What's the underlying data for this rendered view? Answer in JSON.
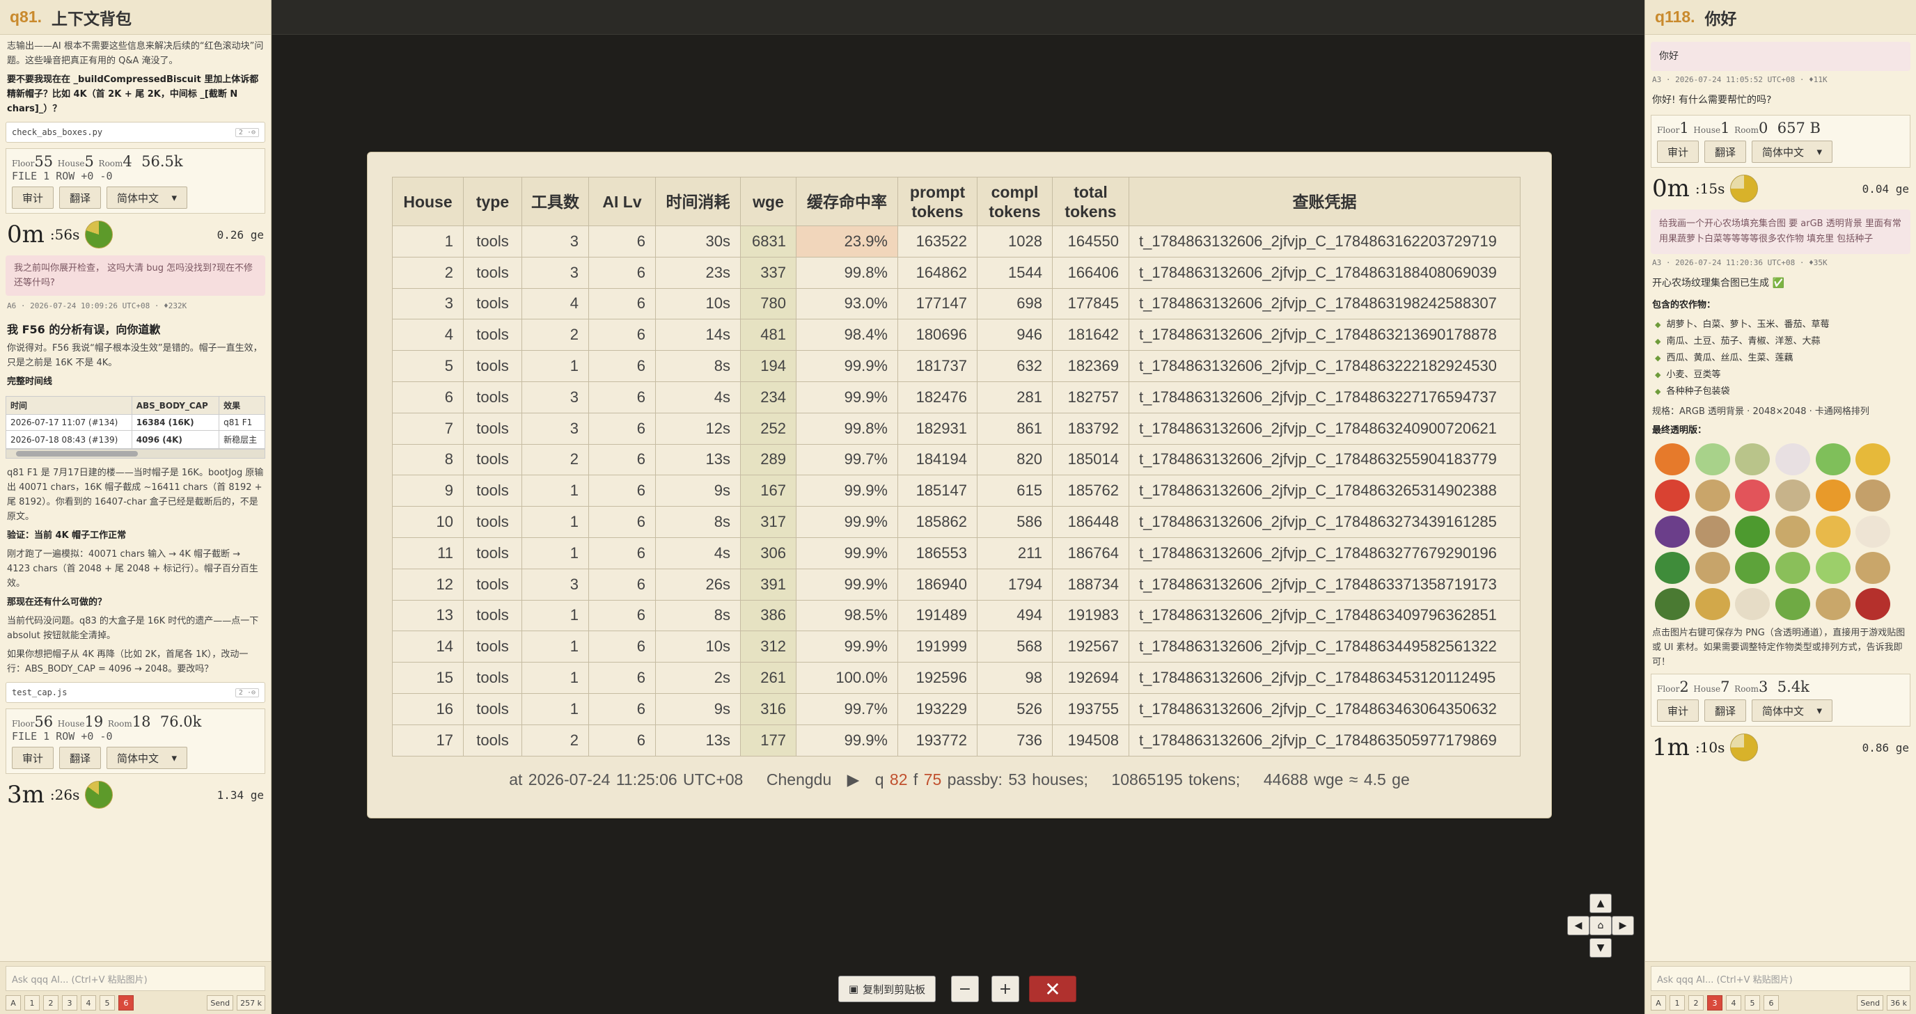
{
  "left_panel": {
    "q_number": "q81.",
    "title": "上下文背包",
    "intro": "志输出——AI 根本不需要这些信息来解决后续的“红色滚动块”问题。这些噪音把真正有用的 Q&A 淹没了。",
    "q1": "要不要我现在在 _buildCompressedBiscuit 里加上体诉都精新帽子？比如 4K（首 2K + 尾 2K，中间标 _[截断 N chars]_）？",
    "code1": "check_abs_boxes.py",
    "code1_badge": "2 ·⊖",
    "stats1": {
      "floor": "55",
      "house": "5",
      "room": "4",
      "size": "56.5k",
      "line2": "FILE 1  ROW +0 -0"
    },
    "btn_review": "审计",
    "btn_translate": "翻译",
    "lang": "简体中文",
    "timer1": {
      "min": "0m",
      "sec": ":56s",
      "ge": "0.26 ge"
    },
    "pink1": "我之前叫你展开检查，  这吗大清 bug 怎吗没找到?现在不修还等什吗?",
    "meta1": "A6 · 2026-07-24 10:09:26 UTC+08 · ♦232K",
    "h_f56": "我 F56 的分析有误，向你道歉",
    "p_f56": "你说得对。F56 我说“帽子根本没生效”是错的。帽子一直生效，只是之前是 16K 不是 4K。",
    "timeline_head": "完整时间线",
    "mini_table": {
      "headers": [
        "时间",
        "ABS_BODY_CAP",
        "效果"
      ],
      "rows": [
        [
          "2026-07-17 11:07 (#134)",
          "16384 (16K)",
          "q81 F1"
        ],
        [
          "2026-07-18 08:43 (#139)",
          "4096 (4K)",
          "新稳层主"
        ]
      ]
    },
    "p2": "q81 F1 是 7月17日建的楼——当时帽子是 16K。bootJog 原输出 40071 chars，16K 帽子截成 ~16411 chars（首 8192 + 尾 8192）。你看到的 16407-char 盒子已经是截断后的，不是原文。",
    "h_verify": "验证：当前 4K 帽子工作正常",
    "p3": "刚才跑了一遍模拟：40071 chars 输入 → 4K 帽子截断 → 4123 chars（首 2048 + 尾 2048 + 标记行）。帽子百分百生效。",
    "h_why": "那现在还有什么可做的？",
    "p4": "当前代码没问题。q83 的大盒子是 16K 时代的遗产——点一下 absolut 按钮就能全清掉。",
    "p5": "如果你想把帽子从 4K 再降（比如 2K，首尾各 1K），改动一行：ABS_BODY_CAP = 4096 → 2048。要改吗？",
    "code2": "test_cap.js",
    "code2_badge": "2 ·⊖",
    "stats2": {
      "floor": "56",
      "house": "19",
      "room": "18",
      "size": "76.0k",
      "line2": "FILE 1  ROW +0 -0"
    },
    "timer2": {
      "min": "3m",
      "sec": ":26s",
      "ge": "1.34 ge"
    },
    "ask_placeholder": "Ask qqq AI... (Ctrl+V 粘贴图片)",
    "pages": [
      "A",
      "1",
      "2",
      "3",
      "4",
      "5",
      "6"
    ],
    "active_page": "6",
    "send": "Send",
    "tokens": "257 k"
  },
  "right_panel": {
    "q_number": "q118.",
    "title": "你好",
    "bubble1": "你好",
    "meta1": "A3 · 2026-07-24 11:05:52 UTC+08 · ♦11K",
    "answer1": "你好! 有什么需要帮忙的吗?",
    "stats1": {
      "floor": "1",
      "house": "1",
      "room": "0",
      "size": "657 B"
    },
    "btn_review": "审计",
    "btn_translate": "翻译",
    "lang": "简体中文",
    "timer1": {
      "min": "0m",
      "sec": ":15s",
      "ge": "0.04 ge"
    },
    "bubble2": "给我画一个开心农场填充集合图 要 arGB 透明背景 里面有常用果蔬萝卜白菜等等等等很多农作物 填充里 包括种子",
    "meta2": "A3 · 2026-07-24 11:20:36 UTC+08 · ♦35K",
    "done": "开心农场纹理集合图已生成 ✅",
    "contains": "包含的农作物：",
    "crops": [
      "胡萝卜、白菜、萝卜、玉米、番茄、草莓",
      "南瓜、土豆、茄子、青椒、洋葱、大蒜",
      "西瓜、黄瓜、丝瓜、生菜、莲藕",
      "小麦、豆类等",
      "各种种子包装袋"
    ],
    "spec": "规格：ARGB 透明背景 · 2048×2048 · 卡通网格排列",
    "final": "最终透明版：",
    "save_note": "点击图片右键可保存为 PNG（含透明通道），直接用于游戏贴图或 UI 素材。如果需要调整特定作物类型或排列方式，告诉我即可！",
    "stats2": {
      "floor": "2",
      "house": "7",
      "room": "3",
      "size": "5.4k"
    },
    "timer2": {
      "min": "1m",
      "sec": ":10s",
      "ge": "0.86 ge"
    },
    "ask_placeholder": "Ask qqq AI... (Ctrl+V 粘贴图片)",
    "pages": [
      "A",
      "1",
      "2",
      "3",
      "4",
      "5",
      "6"
    ],
    "active_page": "3",
    "send": "Send",
    "tokens": "36 k"
  },
  "modal": {
    "headers": [
      "House",
      "type",
      "工具数",
      "AI Lv",
      "时间消耗",
      "wge",
      "缓存命中率",
      "prompt tokens",
      "compl tokens",
      "total tokens",
      "查账凭据"
    ],
    "rows": [
      [
        "1",
        "tools",
        "3",
        "6",
        "30s",
        "6831",
        "23.9%",
        "163522",
        "1028",
        "164550",
        "t_1784863132606_2jfvjp_C_1784863162203729719"
      ],
      [
        "2",
        "tools",
        "3",
        "6",
        "23s",
        "337",
        "99.8%",
        "164862",
        "1544",
        "166406",
        "t_1784863132606_2jfvjp_C_1784863188408069039"
      ],
      [
        "3",
        "tools",
        "4",
        "6",
        "10s",
        "780",
        "93.0%",
        "177147",
        "698",
        "177845",
        "t_1784863132606_2jfvjp_C_1784863198242588307"
      ],
      [
        "4",
        "tools",
        "2",
        "6",
        "14s",
        "481",
        "98.4%",
        "180696",
        "946",
        "181642",
        "t_1784863132606_2jfvjp_C_1784863213690178878"
      ],
      [
        "5",
        "tools",
        "1",
        "6",
        "8s",
        "194",
        "99.9%",
        "181737",
        "632",
        "182369",
        "t_1784863132606_2jfvjp_C_1784863222182924530"
      ],
      [
        "6",
        "tools",
        "3",
        "6",
        "4s",
        "234",
        "99.9%",
        "182476",
        "281",
        "182757",
        "t_1784863132606_2jfvjp_C_1784863227176594737"
      ],
      [
        "7",
        "tools",
        "3",
        "6",
        "12s",
        "252",
        "99.8%",
        "182931",
        "861",
        "183792",
        "t_1784863132606_2jfvjp_C_1784863240900720621"
      ],
      [
        "8",
        "tools",
        "2",
        "6",
        "13s",
        "289",
        "99.7%",
        "184194",
        "820",
        "185014",
        "t_1784863132606_2jfvjp_C_1784863255904183779"
      ],
      [
        "9",
        "tools",
        "1",
        "6",
        "9s",
        "167",
        "99.9%",
        "185147",
        "615",
        "185762",
        "t_1784863132606_2jfvjp_C_1784863265314902388"
      ],
      [
        "10",
        "tools",
        "1",
        "6",
        "8s",
        "317",
        "99.9%",
        "185862",
        "586",
        "186448",
        "t_1784863132606_2jfvjp_C_1784863273439161285"
      ],
      [
        "11",
        "tools",
        "1",
        "6",
        "4s",
        "306",
        "99.9%",
        "186553",
        "211",
        "186764",
        "t_1784863132606_2jfvjp_C_1784863277679290196"
      ],
      [
        "12",
        "tools",
        "3",
        "6",
        "26s",
        "391",
        "99.9%",
        "186940",
        "1794",
        "188734",
        "t_1784863132606_2jfvjp_C_1784863371358719173"
      ],
      [
        "13",
        "tools",
        "1",
        "6",
        "8s",
        "386",
        "98.5%",
        "191489",
        "494",
        "191983",
        "t_1784863132606_2jfvjp_C_1784863409796362851"
      ],
      [
        "14",
        "tools",
        "1",
        "6",
        "10s",
        "312",
        "99.9%",
        "191999",
        "568",
        "192567",
        "t_1784863132606_2jfvjp_C_1784863449582561322"
      ],
      [
        "15",
        "tools",
        "1",
        "6",
        "2s",
        "261",
        "100.0%",
        "192596",
        "98",
        "192694",
        "t_1784863132606_2jfvjp_C_1784863453120112495"
      ],
      [
        "16",
        "tools",
        "1",
        "6",
        "9s",
        "316",
        "99.7%",
        "193229",
        "526",
        "193755",
        "t_1784863132606_2jfvjp_C_1784863463064350632"
      ],
      [
        "17",
        "tools",
        "2",
        "6",
        "13s",
        "177",
        "99.9%",
        "193772",
        "736",
        "194508",
        "t_1784863132606_2jfvjp_C_1784863505977179869"
      ]
    ],
    "status": {
      "time": "at 2026-07-24 11:25:06 UTC+08",
      "city": "Chengdu",
      "q_prefix": "q",
      "q_num": "82",
      "f_prefix": "f",
      "f_num": "75",
      "passby": "passby: 53 houses;",
      "tokens": "10865195 tokens;",
      "wge": "44688 wge ≈ 4.5 ge"
    }
  },
  "toolbar": {
    "copy": "复制到剪贴板",
    "minus": "−",
    "plus": "+",
    "close": "✕"
  },
  "colors": {
    "accent": "#c98a2d",
    "close_red": "#b0312e",
    "highlight_cell": "#f1d6bb",
    "wge_col": "#e6e2c2"
  }
}
